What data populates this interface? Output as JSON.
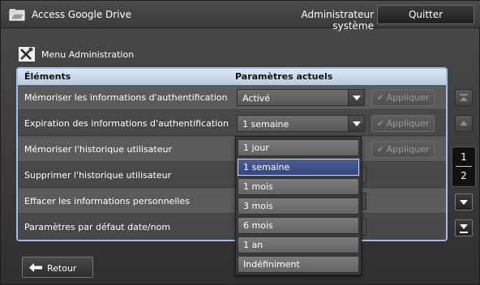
{
  "header": {
    "title": "Access Google Drive",
    "admin_label": "Administrateur système",
    "quit_label": "Quitter"
  },
  "menu": {
    "title": "Menu Administration"
  },
  "table": {
    "columns": [
      "Éléments",
      "Paramètres actuels"
    ],
    "rows": [
      {
        "label": "Mémoriser les informations d'authentification",
        "value": "Activé",
        "apply": "Appliquer"
      },
      {
        "label": "Expiration des informations d'authentification",
        "value": "1 semaine",
        "apply": "Appliquer"
      },
      {
        "label": "Mémoriser l'historique utilisateur",
        "apply": "Appliquer"
      },
      {
        "label": "Supprimer l'historique utilisateur"
      },
      {
        "label": "Effacer les informations personnelles"
      },
      {
        "label": "Paramètres par défaut date/nom"
      }
    ]
  },
  "dropdown": {
    "selected": "1 semaine",
    "options": [
      "1 jour",
      "1 semaine",
      "1 mois",
      "3 mois",
      "6 mois",
      "1 an",
      "Indéfiniment"
    ]
  },
  "pager": {
    "current": "1",
    "total": "2"
  },
  "footer": {
    "back_label": "Retour"
  },
  "colors": {
    "panel_border": "#9cc0e8",
    "selected_option": "#33467d"
  }
}
